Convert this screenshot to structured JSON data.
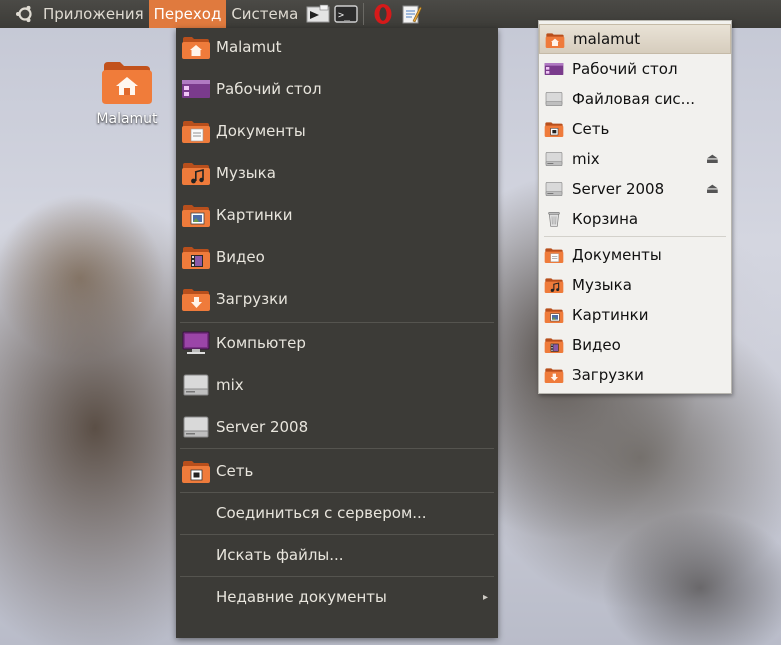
{
  "panel": {
    "menus": [
      "Приложения",
      "Переход",
      "Система"
    ],
    "active_menu": "Переход",
    "accent": "#e07a3e"
  },
  "desktop": {
    "home_label": "Malamut"
  },
  "places_menu": {
    "items": [
      {
        "label": "Malamut",
        "icon": "home-folder-icon"
      },
      {
        "label": "Рабочий стол",
        "icon": "desktop-icon"
      },
      {
        "label": "Документы",
        "icon": "documents-folder-icon"
      },
      {
        "label": "Музыка",
        "icon": "music-folder-icon"
      },
      {
        "label": "Картинки",
        "icon": "pictures-folder-icon"
      },
      {
        "label": "Видео",
        "icon": "video-folder-icon"
      },
      {
        "label": "Загрузки",
        "icon": "downloads-folder-icon"
      },
      {
        "label": "Компьютер",
        "icon": "computer-icon"
      },
      {
        "label": "mix",
        "icon": "drive-icon"
      },
      {
        "label": "Server 2008",
        "icon": "drive-icon"
      },
      {
        "label": "Сеть",
        "icon": "network-folder-icon"
      },
      {
        "label": "Соединиться с сервером...",
        "icon": ""
      },
      {
        "label": "Искать файлы...",
        "icon": ""
      },
      {
        "label": "Недавние документы",
        "icon": "",
        "submenu": "▸"
      }
    ]
  },
  "bookmarks": {
    "items": [
      {
        "label": "malamut",
        "icon": "home-folder-icon"
      },
      {
        "label": "Рабочий стол",
        "icon": "desktop-icon"
      },
      {
        "label": "Файловая сис...",
        "icon": "filesystem-icon"
      },
      {
        "label": "Сеть",
        "icon": "network-folder-icon"
      },
      {
        "label": "mix",
        "icon": "drive-icon",
        "eject": "⏏"
      },
      {
        "label": "Server 2008",
        "icon": "drive-icon",
        "eject": "⏏"
      },
      {
        "label": "Корзина",
        "icon": "trash-icon"
      },
      {
        "label": "Документы",
        "icon": "documents-folder-icon"
      },
      {
        "label": "Музыка",
        "icon": "music-folder-icon"
      },
      {
        "label": "Картинки",
        "icon": "pictures-folder-icon"
      },
      {
        "label": "Видео",
        "icon": "video-folder-icon"
      },
      {
        "label": "Загрузки",
        "icon": "downloads-folder-icon"
      }
    ]
  }
}
